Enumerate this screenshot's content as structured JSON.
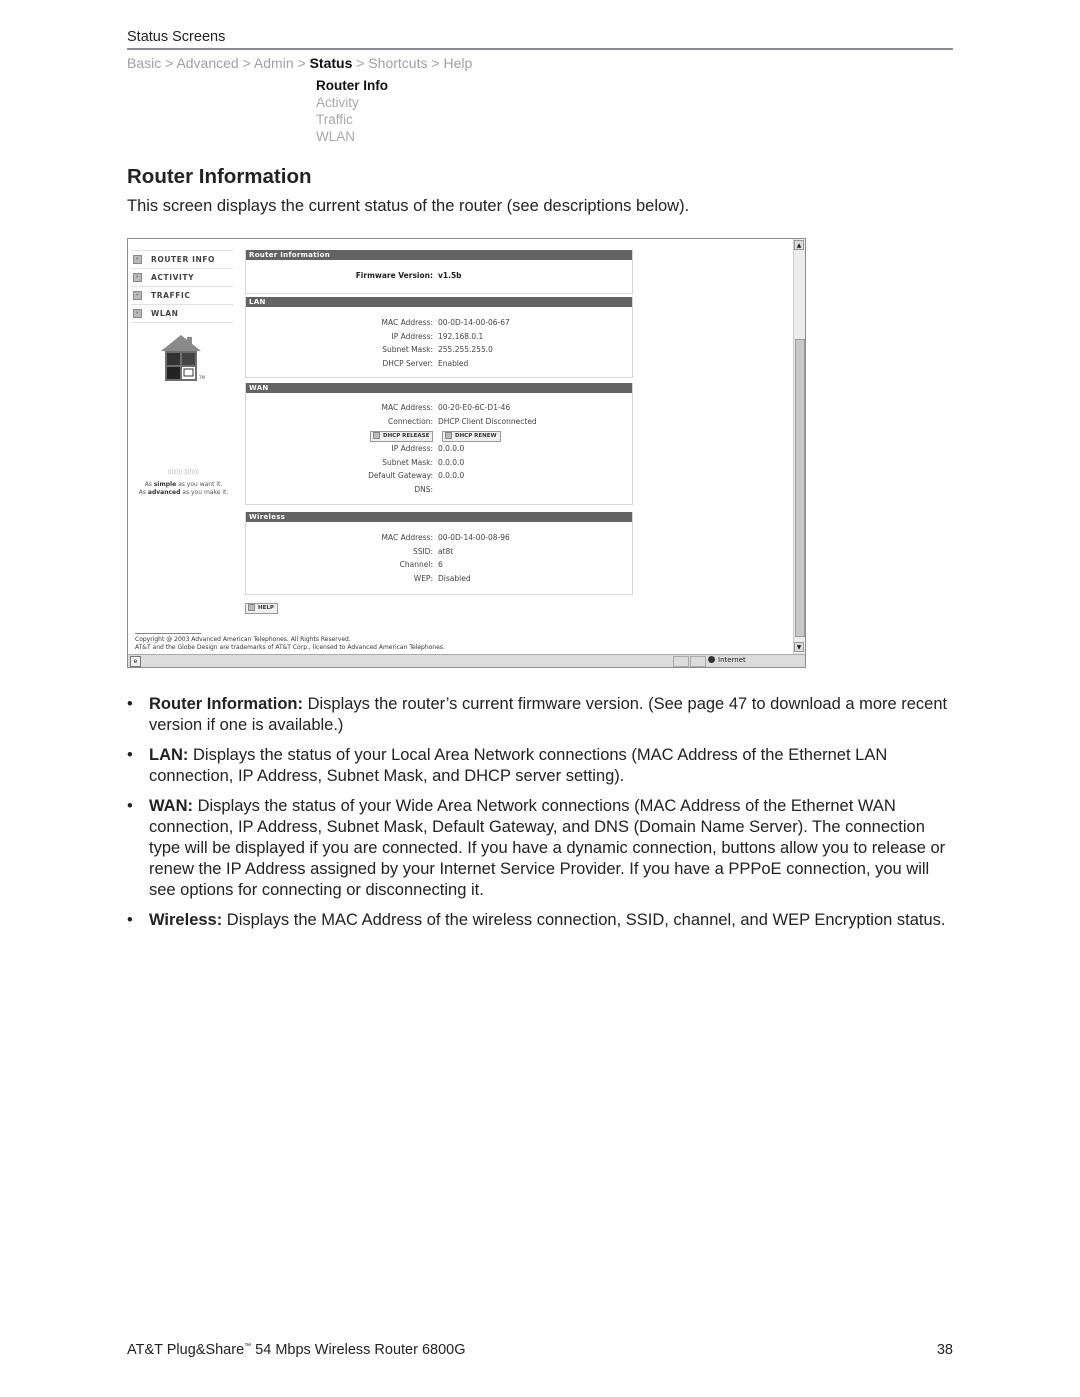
{
  "header": {
    "section_title": "Status Screens",
    "breadcrumb": [
      "Basic",
      "Advanced",
      "Admin",
      "Status",
      "Shortcuts",
      "Help"
    ],
    "breadcrumb_current": "Status",
    "breadcrumb_separator": ">",
    "submenu": [
      {
        "label": "Router Info",
        "active": true
      },
      {
        "label": "Activity",
        "active": false
      },
      {
        "label": "Traffic",
        "active": false
      },
      {
        "label": "WLAN",
        "active": false
      }
    ]
  },
  "title": "Router Information",
  "intro": "This screen displays the current status of the router (see descriptions below).",
  "screenshot": {
    "nav": [
      "ROUTER INFO",
      "ACTIVITY",
      "TRAFFIC",
      "WLAN"
    ],
    "logo_tm": "TM",
    "tagline_1_pre": "As ",
    "tagline_1_bold": "simple",
    "tagline_1_post": " as you want it.",
    "tagline_2_pre": "As ",
    "tagline_2_bold": "advanced",
    "tagline_2_post": " as you make it.",
    "router_info": {
      "header": "Router Information",
      "firmware_label": "Firmware Version:",
      "firmware_value": "v1.5b"
    },
    "lan": {
      "header": "LAN",
      "rows": [
        {
          "k": "MAC Address:",
          "v": "00-0D-14-00-06-67"
        },
        {
          "k": "IP Address:",
          "v": "192.168.0.1"
        },
        {
          "k": "Subnet Mask:",
          "v": "255.255.255.0"
        },
        {
          "k": "DHCP Server:",
          "v": "Enabled"
        }
      ]
    },
    "wan": {
      "header": "WAN",
      "rows_top": [
        {
          "k": "MAC Address:",
          "v": "00-20-E0-6C-D1-46"
        },
        {
          "k": "Connection:",
          "v": "DHCP Client Disconnected"
        }
      ],
      "release_label": "DHCP RELEASE",
      "renew_label": "DHCP RENEW",
      "rows_bottom": [
        {
          "k": "IP Address:",
          "v": "0.0.0.0"
        },
        {
          "k": "Subnet Mask:",
          "v": "0.0.0.0"
        },
        {
          "k": "Default Gateway:",
          "v": "0.0.0.0"
        },
        {
          "k": "DNS:",
          "v": ""
        }
      ]
    },
    "wireless": {
      "header": "Wireless",
      "rows": [
        {
          "k": "MAC Address:",
          "v": "00-0D-14-00-08-96"
        },
        {
          "k": "SSID:",
          "v": "at8t"
        },
        {
          "k": "Channel:",
          "v": "6"
        },
        {
          "k": "WEP:",
          "v": "Disabled"
        }
      ]
    },
    "help_label": "HELP",
    "copyright_1": "Copyright @ 2003 Advanced American Telephones. All Rights Reserved.",
    "copyright_2": "AT&T and the Globe Design are trademarks of AT&T Corp., licensed to Advanced American Telephones.",
    "status_zone": "Internet"
  },
  "bullets": [
    {
      "term": "Router Information:",
      "text": " Displays the router’s current firmware version. (See page 47 to download a more recent version if one is available.)"
    },
    {
      "term": "LAN:",
      "text": " Displays the status of your Local Area Network connections (MAC Address of the Ethernet LAN connection, IP Address, Subnet Mask, and DHCP server setting)."
    },
    {
      "term": "WAN:",
      "text": " Displays the status of your Wide Area Network connections (MAC Address of the Ethernet WAN connection, IP Address, Subnet Mask, Default Gateway, and DNS (Domain Name Server). The connection type will be displayed if you are connected. If you have a dynamic connection, buttons allow you to release or renew the IP Address assigned by your Internet Service Provider. If you have a PPPoE connection, you will see options for connecting or disconnecting it."
    },
    {
      "term": "Wireless:",
      "text": " Displays the MAC Address of the wireless connection, SSID, channel, and WEP Encryption status."
    }
  ],
  "bullet_glyph": "•",
  "footer": {
    "product_pre": "AT&T Plug&Share",
    "product_tm": "™",
    "product_post": " 54 Mbps Wireless Router 6800G",
    "page_number": "38"
  }
}
